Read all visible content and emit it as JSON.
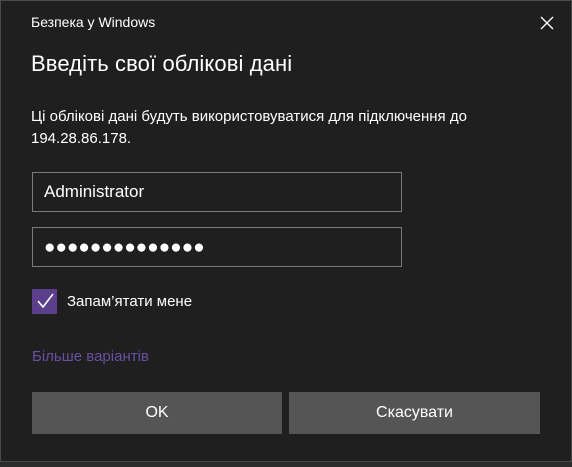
{
  "window": {
    "title": "Безпека у Windows",
    "close_icon": "close-icon"
  },
  "dialog": {
    "heading": "Введіть свої облікові дані",
    "message": "Ці облікові дані будуть використовуватися для підключення до 194.28.86.178.",
    "username_value": "Administrator",
    "password_masked": "●●●●●●●●●●●●●●",
    "remember_label": "Запам’ятати мене",
    "remember_checked": true,
    "more_options_label": "Більше варіантів",
    "ok_label": "OK",
    "cancel_label": "Скасувати"
  },
  "colors": {
    "background": "#1f1f1f",
    "accent": "#5b3f8c",
    "link": "#6a4fa3",
    "button": "#555555",
    "field_border": "#7a7a7a"
  }
}
